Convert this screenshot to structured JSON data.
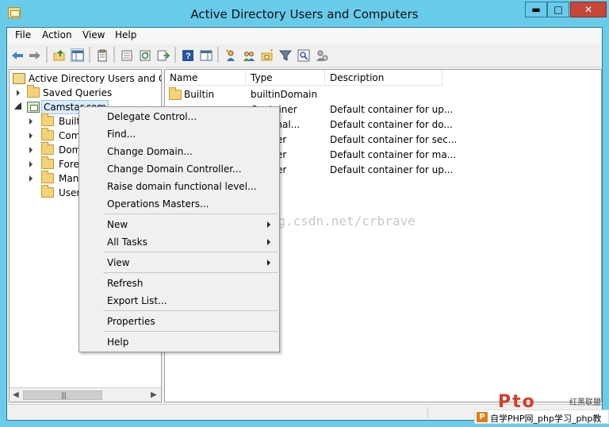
{
  "window": {
    "title": "Active Directory Users and Computers",
    "min_glyph": "▬",
    "max_glyph": "□",
    "close_glyph": "✕"
  },
  "menubar": [
    "File",
    "Action",
    "View",
    "Help"
  ],
  "toolbar": {
    "icons": [
      "back-icon",
      "forward-icon",
      "up-icon",
      "show-tree-icon",
      "properties-icon",
      "export-list-icon",
      "refresh-icon",
      "export-icon",
      "help-icon",
      "show-action-pane-icon",
      "new-user-icon",
      "new-group-icon",
      "new-ou-icon",
      "filter-icon",
      "find-icon",
      "delegate-icon"
    ]
  },
  "tree": {
    "root": "Active Directory Users and Com",
    "saved_queries": "Saved Queries",
    "domain": "Camstar.com",
    "children": [
      "Builti",
      "Com",
      "Doma",
      "Forei",
      "Mana",
      "Users"
    ]
  },
  "list": {
    "columns": [
      "Name",
      "Type",
      "Description"
    ],
    "rows": [
      {
        "name": "Builtin",
        "type": "builtinDomain",
        "description": ""
      },
      {
        "name": "",
        "type": "Container",
        "description": "Default container for up..."
      },
      {
        "name": "",
        "type": "izational...",
        "description": "Default container for do..."
      },
      {
        "name": "",
        "type": "iner",
        "description": "Default container for sec..."
      },
      {
        "name": "",
        "type": "iner",
        "description": "Default container for ma..."
      },
      {
        "name": "",
        "type": "iner",
        "description": "Default container for up..."
      }
    ]
  },
  "context_menu": {
    "items": [
      "Delegate Control...",
      "Find...",
      "Change Domain...",
      "Change Domain Controller...",
      "Raise domain functional level...",
      "Operations Masters...",
      "New",
      "All Tasks",
      "View",
      "Refresh",
      "Export List...",
      "Properties",
      "Help"
    ]
  },
  "watermark": "http://blog.csdn.net/crbrave",
  "branding": {
    "logo_text": "Pto",
    "tag": "红黑联盟",
    "bar_icon": "P",
    "bar_text": "自学PHP网_php学习_php教"
  }
}
